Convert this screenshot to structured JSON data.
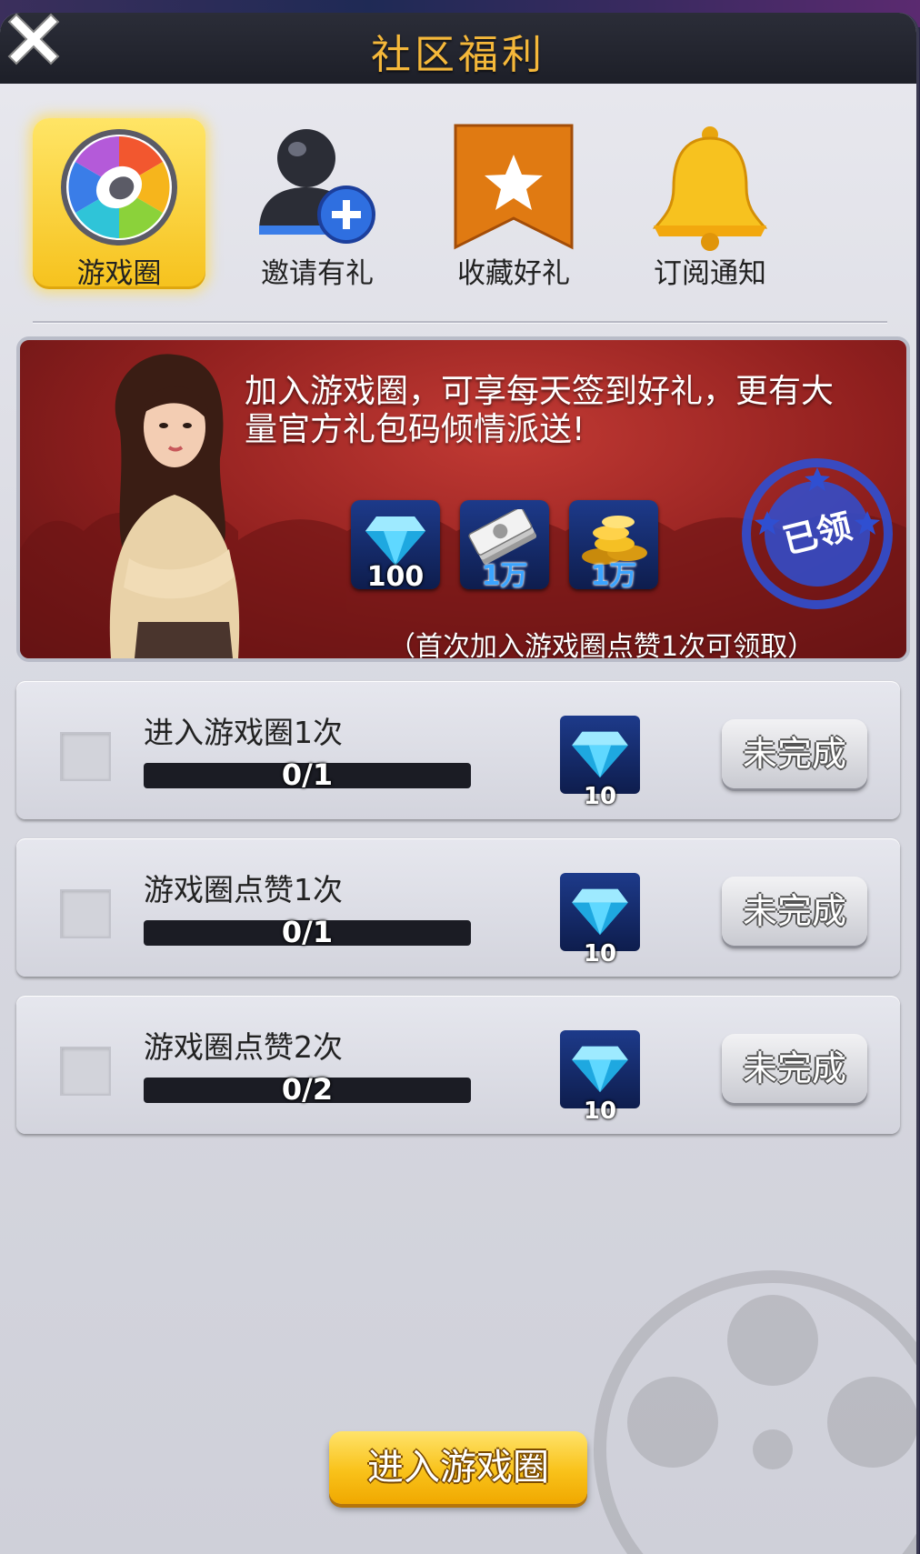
{
  "window": {
    "title": "社区福利"
  },
  "tabs": [
    {
      "label": "游戏圈",
      "icon": "shutter-icon",
      "active": true
    },
    {
      "label": "邀请有礼",
      "icon": "add-user-icon",
      "active": false
    },
    {
      "label": "收藏好礼",
      "icon": "bookmark-star-icon",
      "active": false
    },
    {
      "label": "订阅通知",
      "icon": "bell-icon",
      "active": false
    }
  ],
  "banner": {
    "text": "加入游戏圈，可享每天签到好礼，更有大量官方礼包码倾情派送!",
    "rewards": [
      {
        "icon": "diamond-icon",
        "value": "100"
      },
      {
        "icon": "cash-icon",
        "value": "1万"
      },
      {
        "icon": "gold-coins-icon",
        "value": "1万"
      }
    ],
    "stamp": "已领",
    "note": "（首次加入游戏圈点赞1次可领取）"
  },
  "tasks": [
    {
      "name": "进入游戏圈1次",
      "progress": "0/1",
      "fraction": 0,
      "reward": "10",
      "reward_icon": "diamond-icon",
      "status": "未完成"
    },
    {
      "name": "游戏圈点赞1次",
      "progress": "0/1",
      "fraction": 0,
      "reward": "10",
      "reward_icon": "diamond-icon",
      "status": "未完成"
    },
    {
      "name": "游戏圈点赞2次",
      "progress": "0/2",
      "fraction": 0,
      "reward": "10",
      "reward_icon": "diamond-icon",
      "status": "未完成"
    }
  ],
  "enter_button": {
    "label": "进入游戏圈"
  },
  "colors": {
    "title": "#f5b83a",
    "active_tab": "#f6c21d",
    "banner": "#8f1f1e",
    "stamp": "#2f4fd1"
  }
}
